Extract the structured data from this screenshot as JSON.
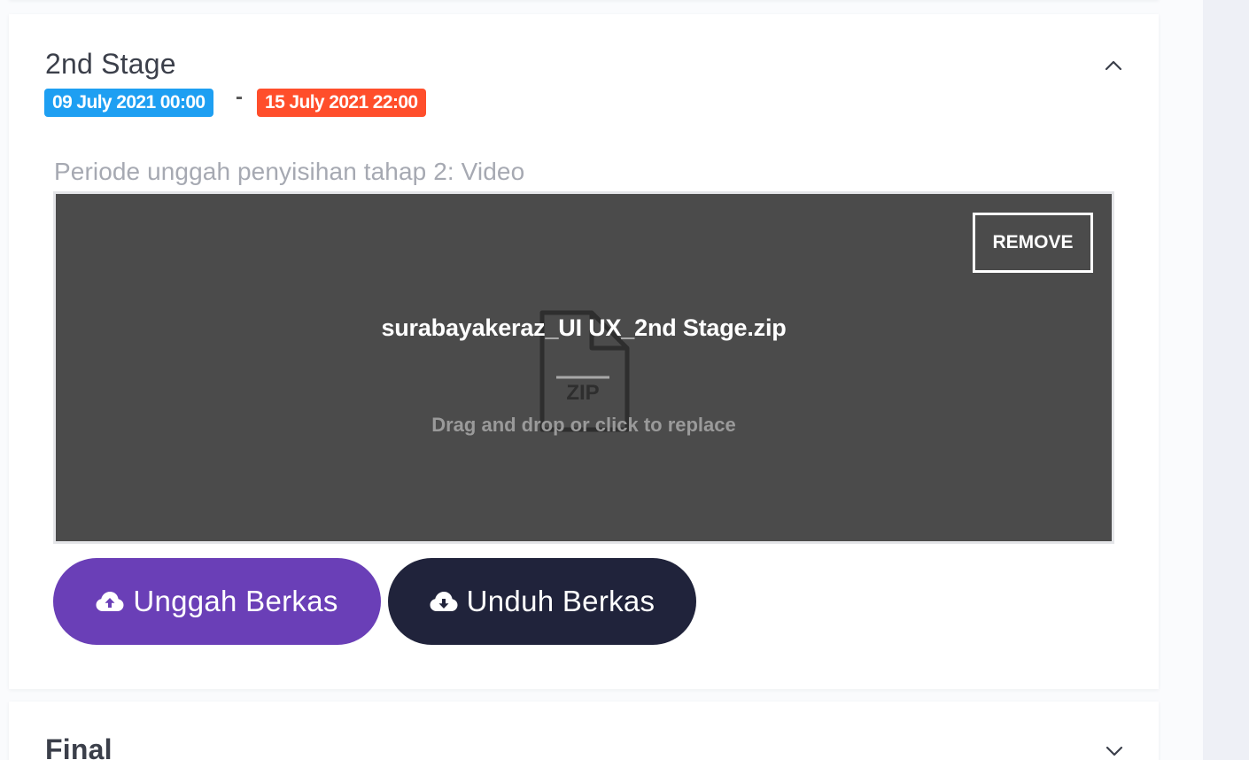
{
  "stage": {
    "title": "2nd Stage",
    "start_date": "09 July 2021 00:00",
    "date_separator": "-",
    "end_date": "15 July 2021 22:00",
    "period_label": "Periode unggah penyisihan tahap 2: Video",
    "dropzone": {
      "file_name": "surabayakeraz_UI UX_2nd Stage.zip",
      "file_type_label": "ZIP",
      "replace_message": "Drag and drop or click to replace",
      "remove_label": "REMOVE"
    },
    "upload_label": "Unggah Berkas",
    "download_label": "Unduh Berkas"
  },
  "final": {
    "title": "Final"
  },
  "colors": {
    "start_badge": "#1e9ff2",
    "end_badge": "#ff4e2b",
    "upload_button": "#6a3fb7",
    "download_button": "#20233b",
    "dropzone_bg": "#4b4b4b"
  },
  "icons": {
    "stage_toggle": "chevron-up-icon",
    "final_toggle": "chevron-down-icon",
    "file": "zip-file-icon",
    "upload": "cloud-upload-icon",
    "download": "cloud-download-icon"
  }
}
